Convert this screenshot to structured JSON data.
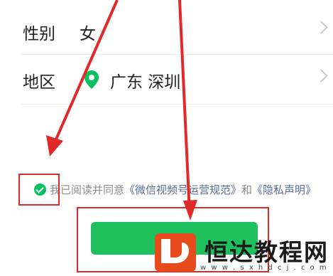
{
  "profile": {
    "gender": {
      "label": "性别",
      "value": "女"
    },
    "region": {
      "label": "地区",
      "value": "广东 深圳"
    }
  },
  "agreement": {
    "prefix": "我已阅读并同意",
    "link1": "《微信视频号运营规范》",
    "middle": "和",
    "link2": "《隐私声明》"
  },
  "watermark": {
    "title": "恒达教程网",
    "url": "w w w . s x h d c j . c o m"
  },
  "colors": {
    "accent": "#07c160",
    "button": "#1fc15f",
    "highlight": "#e02a2a",
    "link": "#576b95"
  }
}
